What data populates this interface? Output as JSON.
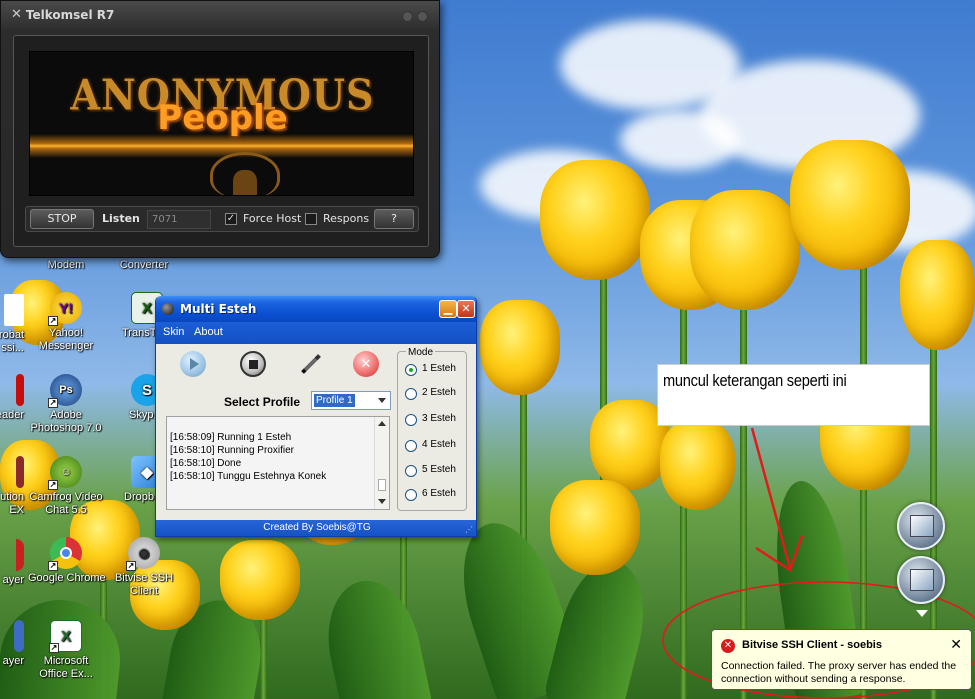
{
  "telkomsel": {
    "title": "Telkomsel R7",
    "banner_line1": "ANONYMOUS",
    "banner_line2": "People",
    "stop_label": "STOP",
    "listen_label": "Listen",
    "port_placeholder": "7071",
    "force_host_label": "Force Host",
    "force_host_checked": true,
    "respons_label": "Respons",
    "respons_checked": false,
    "help_label": "?"
  },
  "desktop_icons": [
    {
      "label": "Modem",
      "icon": "modem-icon"
    },
    {
      "label": "Converter",
      "icon": "converter-icon"
    },
    {
      "label": "robat\nssi...",
      "icon": "acrobat-icon"
    },
    {
      "label": "Yahoo!\nMessenger",
      "icon": "yahoo-messenger-icon"
    },
    {
      "label": "TransT...",
      "icon": "transtool-icon"
    },
    {
      "label": "eader",
      "icon": "reader-icon"
    },
    {
      "label": "Adobe\nPhotoshop 7.0",
      "icon": "photoshop-icon"
    },
    {
      "label": "Skyp...",
      "icon": "skype-icon"
    },
    {
      "label": "ution\nEX",
      "icon": "solution-icon"
    },
    {
      "label": "Camfrog Video\nChat 5.5",
      "icon": "camfrog-icon"
    },
    {
      "label": "Dropb...",
      "icon": "dropbox-icon"
    },
    {
      "label": "ayer",
      "icon": "player-icon"
    },
    {
      "label": "Google Chrome",
      "icon": "chrome-icon"
    },
    {
      "label": "Bitvise SSH\nClient",
      "icon": "bitvise-icon"
    },
    {
      "label": "ayer",
      "icon": "player2-icon"
    },
    {
      "label": "Microsoft\nOffice Ex...",
      "icon": "excel-icon"
    }
  ],
  "esteh": {
    "title": "Multi Esteh",
    "menu": [
      "Skin",
      "About"
    ],
    "select_profile_label": "Select Profile",
    "profile_value": "Profile 1",
    "log_lines": [
      "[16:58:09]  Running 1 Esteh",
      "[16:58:10]  Running Proxifier",
      "[16:58:10]  Done",
      "[16:58:10]  Tunggu Estehnya Konek"
    ],
    "mode_label": "Mode",
    "modes": [
      "1 Esteh",
      "2 Esteh",
      "3 Esteh",
      "4 Esteh",
      "5 Esteh",
      "6 Esteh"
    ],
    "selected_mode": 0,
    "footer": "Created By Soebis@TG",
    "colors": {
      "titlebar": "#0a4fd1",
      "body": "#ecebe3"
    }
  },
  "annotation": {
    "text": "muncul keterangan seperti ini",
    "arrow_color": "#e31a1a"
  },
  "balloon": {
    "title": "Bitvise SSH Client - soebis",
    "message": "Connection failed. The proxy server has ended the connection without sending a response.",
    "close_label": "✕"
  }
}
